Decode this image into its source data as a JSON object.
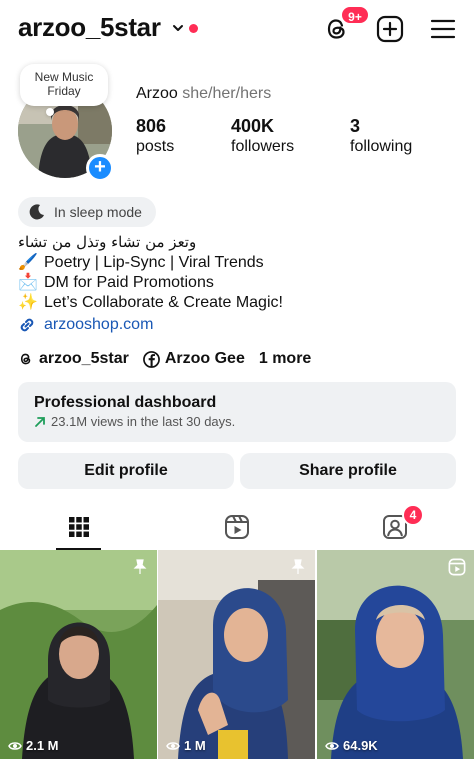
{
  "header": {
    "username": "arzoo_5star",
    "notifications_badge": "9+"
  },
  "profile": {
    "note": "New Music Friday",
    "name": "Arzoo",
    "pronouns": "she/her/hers",
    "stats": [
      {
        "value": "806",
        "label": "posts"
      },
      {
        "value": "400K",
        "label": "followers"
      },
      {
        "value": "3",
        "label": "following"
      }
    ],
    "status": "In sleep mode",
    "bio": [
      {
        "icon": "",
        "text": "وتعز من تشاء وتذل من تشاء"
      },
      {
        "icon": "🖌️",
        "text": "Poetry | Lip-Sync | Viral Trends"
      },
      {
        "icon": "📩",
        "text": "DM for Paid Promotions"
      },
      {
        "icon": "✨",
        "text": "Let’s Collaborate & Create Magic!"
      }
    ],
    "link": "arzooshop.com",
    "social": {
      "threads": "arzoo_5star",
      "facebook": "Arzoo Gee",
      "more": "1 more"
    }
  },
  "dashboard": {
    "title": "Professional dashboard",
    "subtitle": "23.1M views in the last 30 days."
  },
  "buttons": {
    "edit": "Edit profile",
    "share": "Share profile"
  },
  "tabs": {
    "tagged_badge": "4"
  },
  "posts": [
    {
      "views": "2.1 M",
      "pinned": true
    },
    {
      "views": "1 M",
      "pinned": true
    },
    {
      "views": "64.9K",
      "pinned": false
    }
  ],
  "colors": {
    "accent_red": "#ff2d55",
    "link_blue": "#1a58b5",
    "button_gray": "#eff1f3"
  }
}
